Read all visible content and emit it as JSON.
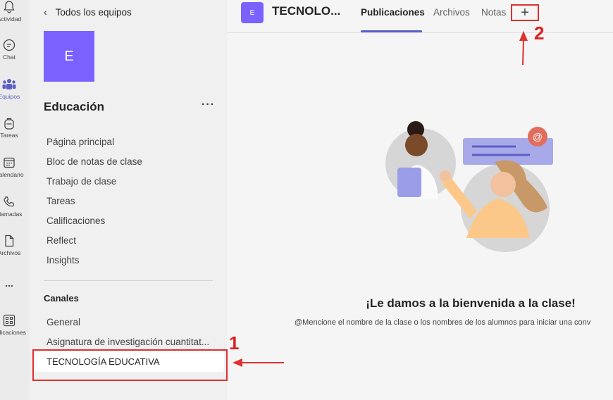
{
  "rail": {
    "items": [
      {
        "label": "Actividad"
      },
      {
        "label": "Chat"
      },
      {
        "label": "Equipos"
      },
      {
        "label": "Tareas"
      },
      {
        "label": "Calendario"
      },
      {
        "label": "Llamadas"
      },
      {
        "label": "Archivos"
      },
      {
        "label": "..."
      },
      {
        "label": "Aplicaciones"
      }
    ],
    "active_color": "#5b5fc7"
  },
  "panel": {
    "back_label": "Todos los equipos",
    "team_initial": "E",
    "team_name": "Educación",
    "more": "···",
    "nav": [
      "Página principal",
      "Bloc de notas de clase",
      "Trabajo de clase",
      "Tareas",
      "Calificaciones",
      "Reflect",
      "Insights"
    ],
    "channels_header": "Canales",
    "channels": [
      "General",
      "Asignatura de investigación cuantitat...",
      "TECNOLOGÍA EDUCATIVA"
    ]
  },
  "header": {
    "channel_initial": "E",
    "channel_title": "TECNOLO...",
    "tabs": [
      "Publicaciones",
      "Archivos",
      "Notas"
    ],
    "add_tab": "+"
  },
  "welcome": {
    "title": "¡Le damos a la bienvenida a la clase!",
    "subtitle": "@Mencione el nombre de la clase o los nombres de los alumnos para iniciar una conv"
  },
  "annotations": {
    "step1": "1",
    "step2": "2",
    "color": "#e03030"
  },
  "colors": {
    "brand": "#7b61ff",
    "accent": "#5b5fc7"
  }
}
